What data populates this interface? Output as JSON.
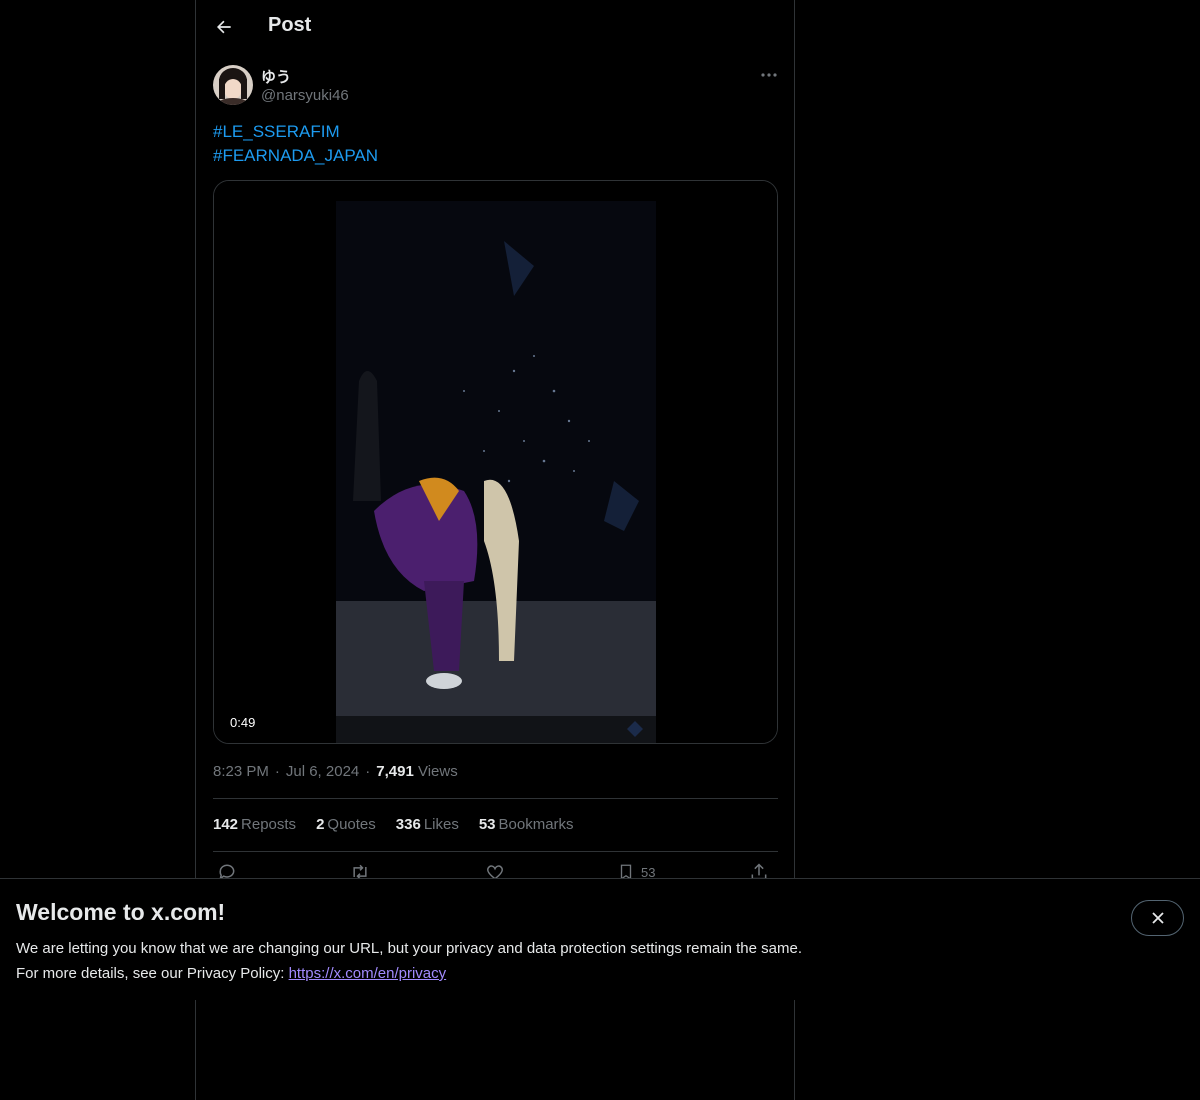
{
  "header": {
    "title": "Post"
  },
  "author": {
    "display_name": "ゆう",
    "handle": "@narsyuki46"
  },
  "post": {
    "hashtags": [
      "#LE_SSERAFIM",
      "#FEARNADA_JAPAN"
    ],
    "video_duration": "0:49",
    "time": "8:23 PM",
    "date": "Jul 6, 2024",
    "views_count": "7,491",
    "views_label": "Views"
  },
  "stats": {
    "reposts_count": "142",
    "reposts_label": "Reposts",
    "quotes_count": "2",
    "quotes_label": "Quotes",
    "likes_count": "336",
    "likes_label": "Likes",
    "bookmarks_count": "53",
    "bookmarks_label": "Bookmarks"
  },
  "actions": {
    "bookmark_count": "53"
  },
  "banner": {
    "title": "Welcome to x.com!",
    "line1": "We are letting you know that we are changing our URL, but your privacy and data protection settings remain the same.",
    "line2_prefix": "For more details, see our Privacy Policy: ",
    "link_text": "https://x.com/en/privacy"
  },
  "colors": {
    "accent": "#1d9bf0",
    "link": "#a28bfe",
    "muted": "#71767b",
    "text": "#e7e9ea",
    "border": "#2f3336"
  }
}
